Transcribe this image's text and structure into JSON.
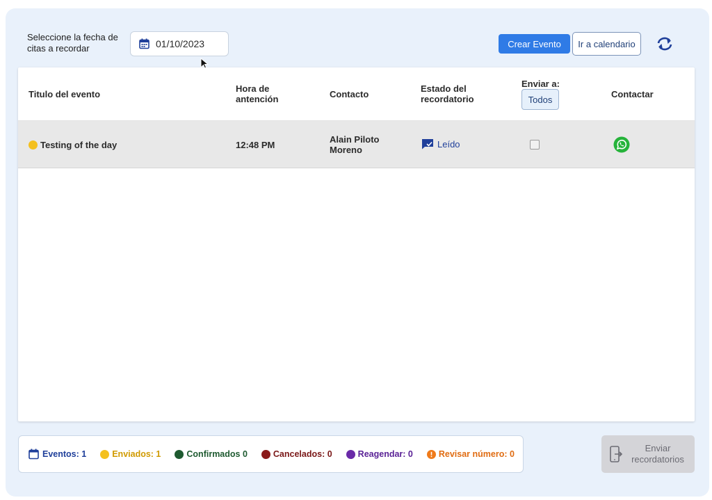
{
  "filter": {
    "date_label": "Seleccione la fecha de citas a recordar",
    "date_value": "01/10/2023"
  },
  "toolbar": {
    "create_event_label": "Crear Evento",
    "go_calendar_label": "Ir a calendario"
  },
  "table": {
    "headers": {
      "title": "Titulo del evento",
      "hour": "Hora de antención",
      "contact": "Contacto",
      "status": "Estado del recordatorio",
      "send_to": "Enviar a:",
      "send_to_button": "Todos",
      "contact_action": "Contactar"
    },
    "rows": [
      {
        "title": "Testing of the day",
        "hour": "12:48 PM",
        "contact": "Alain Piloto Moreno",
        "status": "Leído",
        "send_checked": false
      }
    ]
  },
  "summary": {
    "events": "Eventos: 1",
    "sent": "Enviados: 1",
    "confirmed": "Confirmados 0",
    "cancelled": "Cancelados: 0",
    "reschedule": "Reagendar: 0",
    "check_number": "Revisar número: 0"
  },
  "send_reminders_label": "Enviar recordatorios",
  "colors": {
    "accent": "#2f7be6",
    "sent": "#f4c01e",
    "confirmed": "#1e5a30",
    "cancelled": "#8b1a1a",
    "reschedule": "#6a2aa8",
    "check_number": "#ef7a1a"
  }
}
